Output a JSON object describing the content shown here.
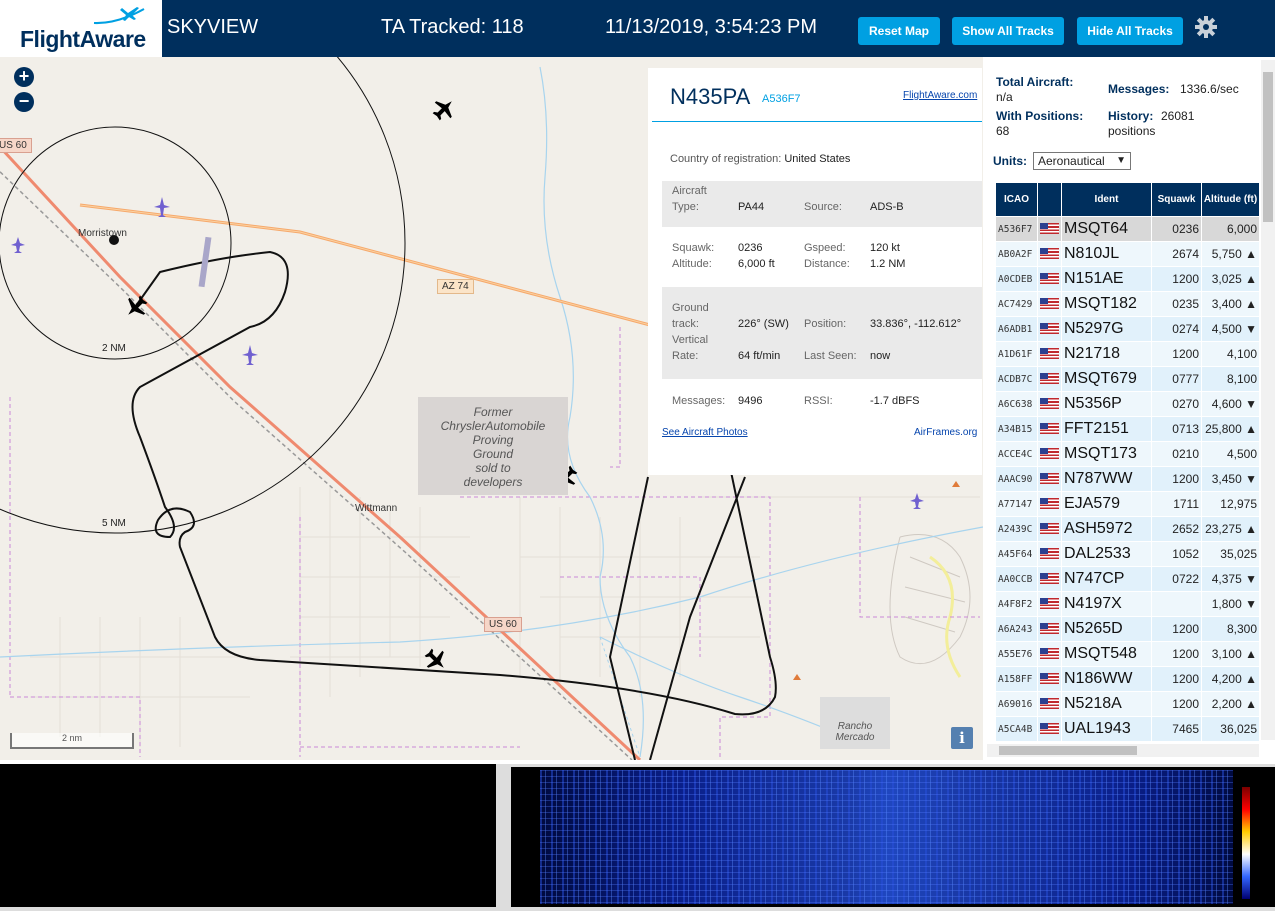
{
  "header": {
    "logo_text": "FlightAware",
    "title": "SKYVIEW",
    "tracked": "TA Tracked: 118",
    "datetime": "11/13/2019, 3:54:23 PM",
    "reset_label": "Reset Map",
    "show_label": "Show All Tracks",
    "hide_label": "Hide All Tracks"
  },
  "map": {
    "zoom_in": "+",
    "zoom_out": "−",
    "places": {
      "morristown": "Morristown",
      "wittmann": "Wittmann"
    },
    "range_rings": {
      "r2": "2 NM",
      "r5": "5 NM"
    },
    "roads": {
      "us60_top": "US 60",
      "az74": "AZ 74",
      "us60_bottom": "US 60"
    },
    "proving_ground": [
      "Former",
      "ChryslerAutomobile",
      "Proving",
      "Ground",
      "sold to",
      "developers"
    ],
    "rancho": [
      "Rancho",
      "Mercado"
    ],
    "scale": "2 nm",
    "info": "i"
  },
  "selected": {
    "ident": "N435PA",
    "icao": "A536F7",
    "fa_link": "FlightAware.com",
    "country_label": "Country of registration:",
    "country": "United States",
    "aircraft_type_label1": "Aircraft",
    "aircraft_type_label2": "Type:",
    "aircraft_type": "PA44",
    "source_label": "Source:",
    "source": "ADS-B",
    "squawk_label": "Squawk:",
    "squawk": "0236",
    "gspeed_label": "Gspeed:",
    "gspeed": "120 kt",
    "altitude_label": "Altitude:",
    "altitude": "6,000 ft",
    "distance_label": "Distance:",
    "distance": "1.2 NM",
    "track_label1": "Ground",
    "track_label2": "track:",
    "track": "226° (SW)",
    "position_label": "Position:",
    "position": "33.836°, -112.612°",
    "vrate_label1": "Vertical",
    "vrate_label2": "Rate:",
    "vrate": "64 ft/min",
    "lastseen_label": "Last Seen:",
    "lastseen": "now",
    "messages_label": "Messages:",
    "messages": "9496",
    "rssi_label": "RSSI:",
    "rssi": "-1.7 dBFS",
    "photos_link": "See Aircraft Photos",
    "airframes_link": "AirFrames.org"
  },
  "sidebar": {
    "total_label": "Total Aircraft:",
    "total": "n/a",
    "messages_label": "Messages:",
    "messages": "1336.6/sec",
    "positions_label": "With Positions:",
    "positions": "68",
    "history_label": "History:",
    "history": "26081",
    "history_unit": "positions",
    "units_label": "Units:",
    "units_value": "Aeronautical"
  },
  "table": {
    "headers": [
      "ICAO",
      "",
      "Ident",
      "Squawk",
      "Altitude (ft)"
    ],
    "rows": [
      {
        "icao": "A536F7",
        "ident": "MSQT64",
        "squawk": "0236",
        "alt": "6,000"
      },
      {
        "icao": "AB0A2F",
        "ident": "N810JL",
        "squawk": "2674",
        "alt": "5,750 ▲"
      },
      {
        "icao": "A0CDEB",
        "ident": "N151AE",
        "squawk": "1200",
        "alt": "3,025 ▲"
      },
      {
        "icao": "AC7429",
        "ident": "MSQT182",
        "squawk": "0235",
        "alt": "3,400 ▲"
      },
      {
        "icao": "A6ADB1",
        "ident": "N5297G",
        "squawk": "0274",
        "alt": "4,500 ▼"
      },
      {
        "icao": "A1D61F",
        "ident": "N21718",
        "squawk": "1200",
        "alt": "4,100"
      },
      {
        "icao": "ACDB7C",
        "ident": "MSQT679",
        "squawk": "0777",
        "alt": "8,100"
      },
      {
        "icao": "A6C638",
        "ident": "N5356P",
        "squawk": "0270",
        "alt": "4,600 ▼"
      },
      {
        "icao": "A34B15",
        "ident": "FFT2151",
        "squawk": "0713",
        "alt": "25,800 ▲"
      },
      {
        "icao": "ACCE4C",
        "ident": "MSQT173",
        "squawk": "0210",
        "alt": "4,500"
      },
      {
        "icao": "AAAC90",
        "ident": "N787WW",
        "squawk": "1200",
        "alt": "3,450 ▼"
      },
      {
        "icao": "A77147",
        "ident": "EJA579",
        "squawk": "1711",
        "alt": "12,975"
      },
      {
        "icao": "A2439C",
        "ident": "ASH5972",
        "squawk": "2652",
        "alt": "23,275 ▲"
      },
      {
        "icao": "A45F64",
        "ident": "DAL2533",
        "squawk": "1052",
        "alt": "35,025"
      },
      {
        "icao": "AA0CCB",
        "ident": "N747CP",
        "squawk": "0722",
        "alt": "4,375 ▼"
      },
      {
        "icao": "A4F8F2",
        "ident": "N4197X",
        "squawk": "",
        "alt": "1,800 ▼"
      },
      {
        "icao": "A6A243",
        "ident": "N5265D",
        "squawk": "1200",
        "alt": "8,300"
      },
      {
        "icao": "A55E76",
        "ident": "MSQT548",
        "squawk": "1200",
        "alt": "3,100 ▲"
      },
      {
        "icao": "A158FF",
        "ident": "N186WW",
        "squawk": "1200",
        "alt": "4,200 ▲"
      },
      {
        "icao": "A69016",
        "ident": "N5218A",
        "squawk": "1200",
        "alt": "2,200 ▲"
      },
      {
        "icao": "A5CA4B",
        "ident": "UAL1943",
        "squawk": "7465",
        "alt": "36,025"
      }
    ]
  },
  "colors": {
    "header_bg": "#002f5d",
    "button_bg": "#00a0e2",
    "track_color": "#111111",
    "road_orange": "#f6a96c"
  }
}
